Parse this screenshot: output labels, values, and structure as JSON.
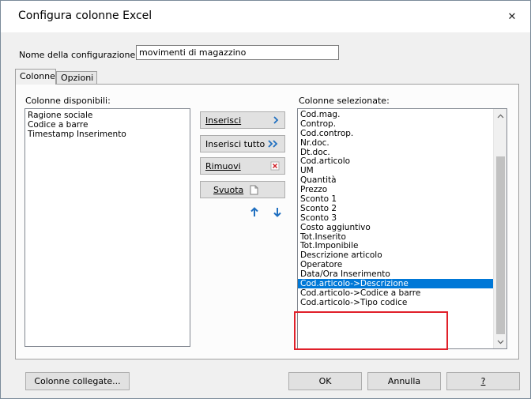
{
  "window": {
    "title": "Configura colonne Excel",
    "close_glyph": "✕"
  },
  "config_name": {
    "label": "Nome della configurazione:",
    "value": "movimenti di magazzino"
  },
  "tabs": [
    {
      "label": "Colonne",
      "active": true
    },
    {
      "label": "Opzioni",
      "active": false
    }
  ],
  "available": {
    "label": "Colonne disponibili:",
    "items": [
      "Ragione sociale",
      "Codice a barre",
      "Timestamp Inserimento"
    ]
  },
  "selected": {
    "label": "Colonne selezionate:",
    "items": [
      "Cod.mag.",
      "Controp.",
      "Cod.controp.",
      "Nr.doc.",
      "Dt.doc.",
      "Cod.articolo",
      "UM",
      "Quantità",
      "Prezzo",
      "Sconto 1",
      "Sconto 2",
      "Sconto 3",
      "Costo aggiuntivo",
      "Tot.Inserito",
      "Tot.Imponibile",
      "Descrizione articolo",
      "Operatore",
      "Data/Ora Inserimento",
      "Cod.articolo->Descrizione",
      "Cod.articolo->Codice a barre",
      "Cod.articolo->Tipo codice"
    ],
    "selected_index": 18
  },
  "buttons": {
    "insert": "Inserisci",
    "insert_all": "Inserisci tutto",
    "remove": "Rimuovi",
    "clear": "Svuota",
    "linked_columns": "Colonne collegate...",
    "ok": "OK",
    "cancel": "Annulla",
    "help": "?"
  },
  "icons": {
    "insert": "chevron-right-icon",
    "insert_all": "double-chevron-right-icon",
    "remove": "remove-x-icon",
    "clear": "blank-page-icon",
    "move_up": "arrow-up-icon",
    "move_down": "arrow-down-icon"
  },
  "colors": {
    "accent": "#0078d7",
    "highlight_frame": "#e0202a",
    "arrow": "#1f6fc0"
  }
}
